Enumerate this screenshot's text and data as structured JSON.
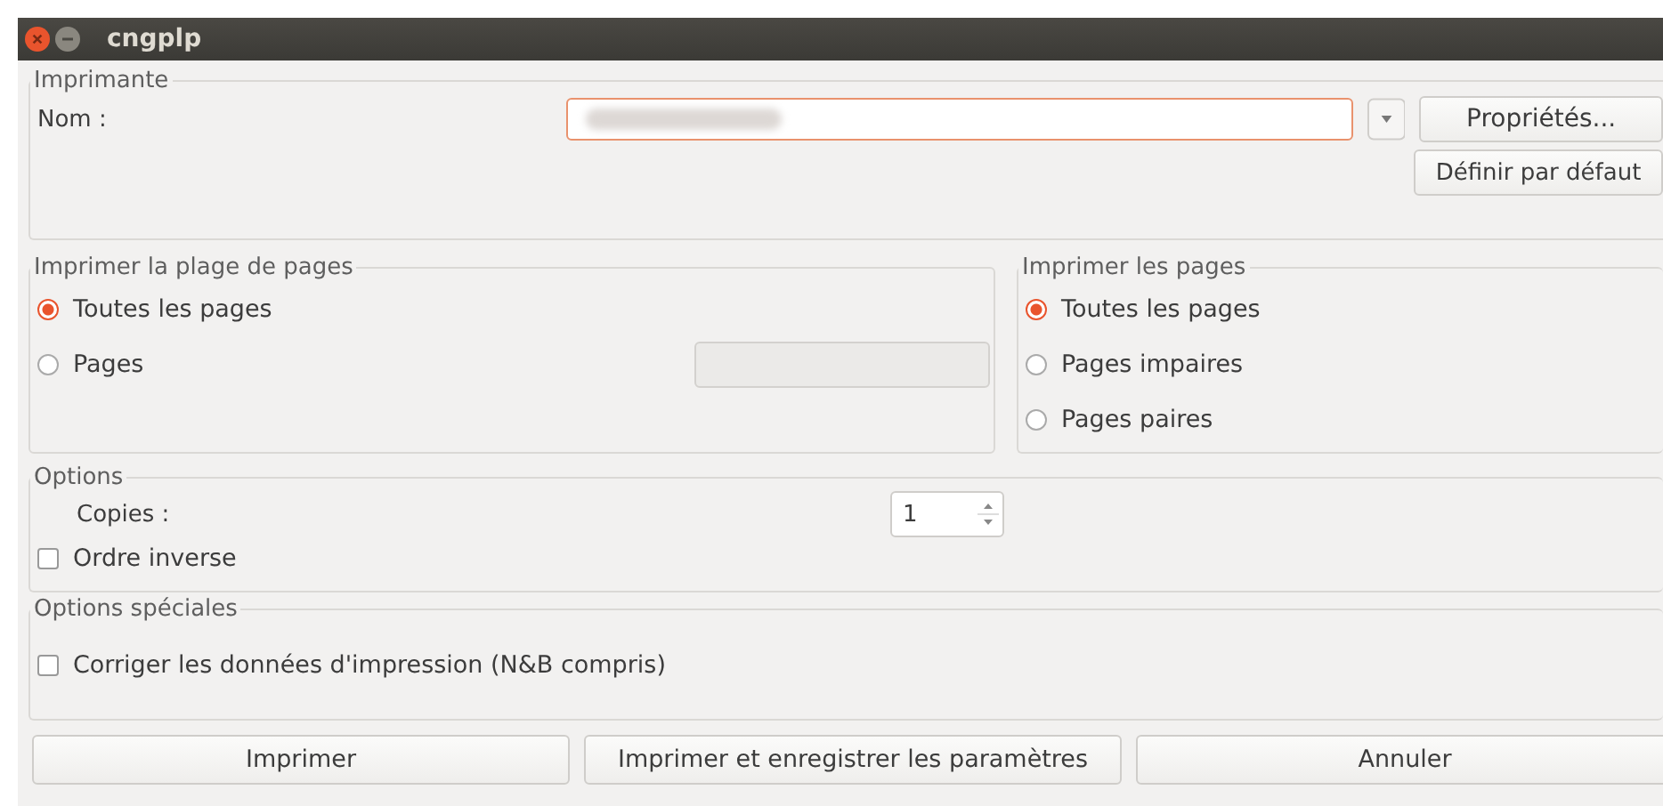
{
  "window": {
    "title": "cngplp"
  },
  "printer": {
    "legend": "Imprimante",
    "name_label": "Nom :",
    "name_field": {
      "focused": true
    },
    "properties_button": "Propriétés...",
    "default_button": "Définir par défaut"
  },
  "page_range": {
    "legend": "Imprimer la plage de pages",
    "options": [
      {
        "label": "Toutes les pages",
        "selected": true
      },
      {
        "label": "Pages",
        "selected": false
      }
    ],
    "pages_field": {
      "disabled": true
    }
  },
  "page_set": {
    "legend": "Imprimer les pages",
    "options": [
      {
        "label": "Toutes les pages",
        "selected": true
      },
      {
        "label": "Pages impaires",
        "selected": false
      },
      {
        "label": "Pages paires",
        "selected": false
      }
    ]
  },
  "options": {
    "legend": "Options",
    "copies_label": "Copies :",
    "copies_value": "1",
    "reverse_order": {
      "label": "Ordre inverse",
      "checked": false
    }
  },
  "special_options": {
    "legend": "Options spéciales",
    "correct_data": {
      "label": "Corriger les données d'impression (N&B compris)",
      "checked": false
    }
  },
  "buttons": [
    "Imprimer",
    "Imprimer et enregistrer les paramètres",
    "Annuler"
  ]
}
